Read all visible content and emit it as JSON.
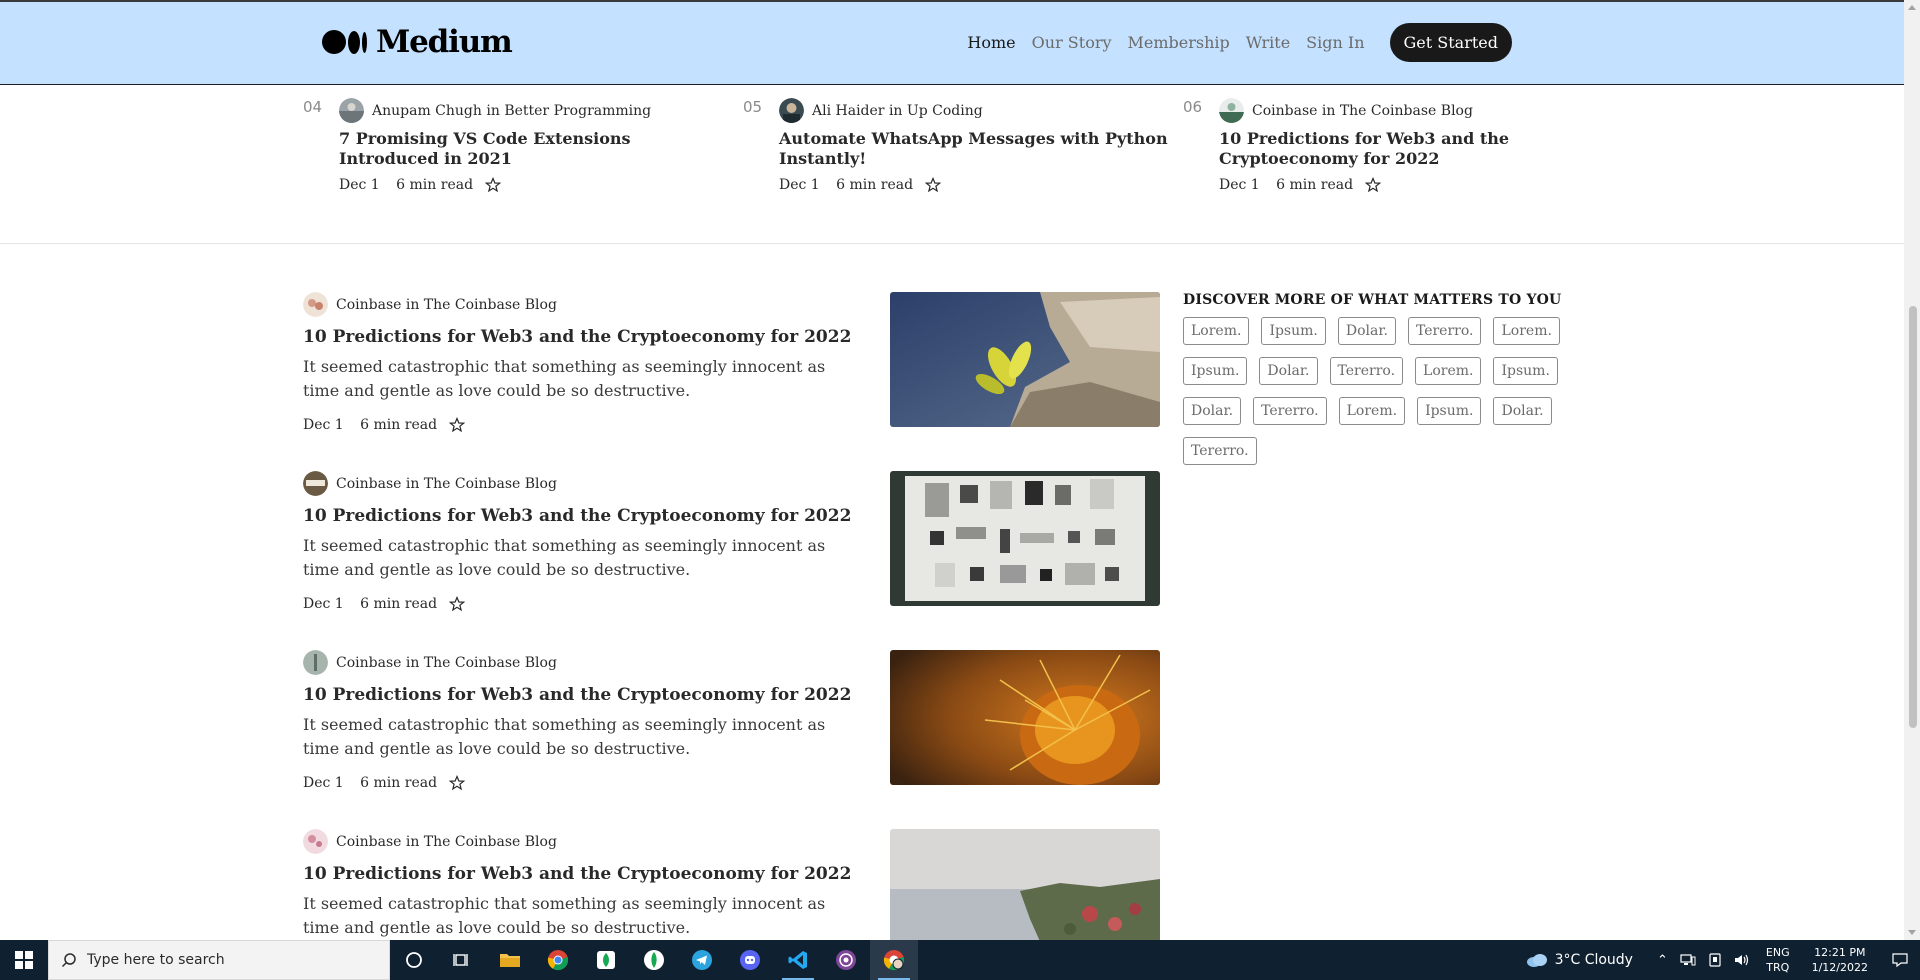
{
  "header": {
    "logo_text": "Medium",
    "nav": [
      {
        "label": "Home",
        "active": true
      },
      {
        "label": "Our Story",
        "active": false
      },
      {
        "label": "Membership",
        "active": false
      },
      {
        "label": "Write",
        "active": false
      },
      {
        "label": "Sign In",
        "active": false
      }
    ],
    "cta_label": "Get Started"
  },
  "trending": [
    {
      "number": "04",
      "author": "Anupam Chugh",
      "in": "in",
      "publication": "Better Programming",
      "title": "7 Promising VS Code Extensions Introduced in 2021",
      "date": "Dec 1",
      "read_time": "6 min read"
    },
    {
      "number": "05",
      "author": "Ali Haider",
      "in": "in",
      "publication": "Up Coding",
      "title": "Automate WhatsApp Messages with Python Instantly!",
      "date": "Dec 1",
      "read_time": "6 min read"
    },
    {
      "number": "06",
      "author": "Coinbase",
      "in": "in",
      "publication": "The Coinbase Blog",
      "title": "10 Predictions for Web3 and the Cryptoeconomy for 2022",
      "date": "Dec 1",
      "read_time": "6 min read"
    }
  ],
  "posts": [
    {
      "author_line": "Coinbase in The Coinbase Blog",
      "title": "10 Predictions for Web3 and the Cryptoeconomy for 2022",
      "subtitle": "It seemed catastrophic that something as seemingly innocent as time and gentle as love could be so destructive.",
      "date": "Dec 1",
      "read_time": "6 min read"
    },
    {
      "author_line": "Coinbase in The Coinbase Blog",
      "title": "10 Predictions for Web3 and the Cryptoeconomy for 2022",
      "subtitle": "It seemed catastrophic that something as seemingly innocent as time and gentle as love could be so destructive.",
      "date": "Dec 1",
      "read_time": "6 min read"
    },
    {
      "author_line": "Coinbase in The Coinbase Blog",
      "title": "10 Predictions for Web3 and the Cryptoeconomy for 2022",
      "subtitle": "It seemed catastrophic that something as seemingly innocent as time and gentle as love could be so destructive.",
      "date": "Dec 1",
      "read_time": "6 min read"
    },
    {
      "author_line": "Coinbase in The Coinbase Blog",
      "title": "10 Predictions for Web3 and the Cryptoeconomy for 2022",
      "subtitle": "It seemed catastrophic that something as seemingly innocent as time and gentle as love could be so destructive.",
      "date": "",
      "read_time": ""
    }
  ],
  "sidebar": {
    "title": "DISCOVER MORE OF WHAT MATTERS TO YOU",
    "tags": [
      "Lorem.",
      "Ipsum.",
      "Dolar.",
      "Tererro.",
      "Lorem.",
      "Ipsum.",
      "Dolar.",
      "Tererro.",
      "Lorem.",
      "Ipsum.",
      "Dolar.",
      "Tererro.",
      "Lorem.",
      "Ipsum.",
      "Dolar.",
      "Tererro."
    ]
  },
  "taskbar": {
    "search_placeholder": "Type here to search",
    "weather": "3°C  Cloudy",
    "lang_top": "ENG",
    "lang_bottom": "TRQ",
    "time": "12:21 PM",
    "date": "1/12/2022"
  },
  "colors": {
    "header_bg": "#c4e2ff",
    "cta_bg": "#191919",
    "taskbar_bg": "#0f2031"
  }
}
